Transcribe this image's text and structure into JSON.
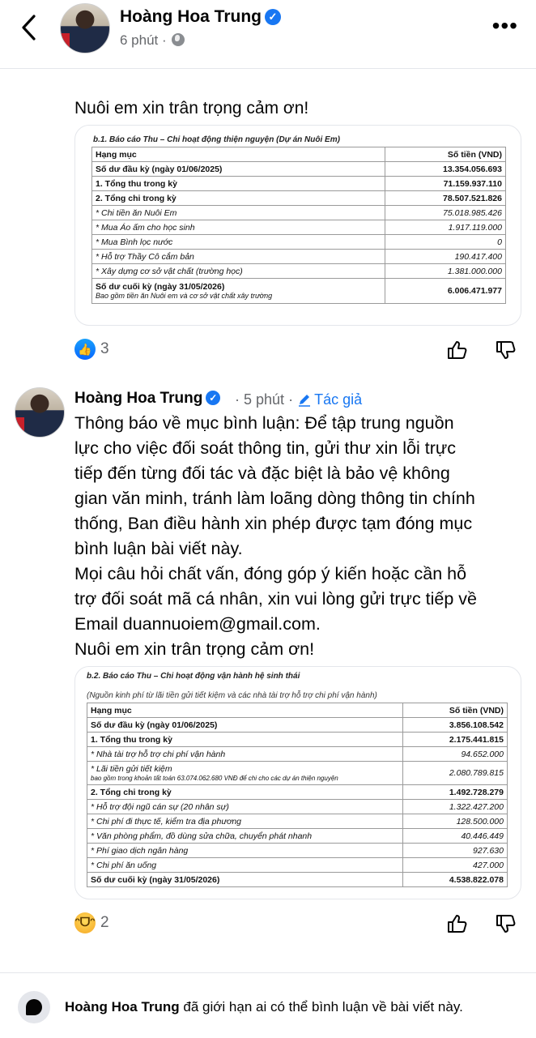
{
  "header": {
    "author": "Hoàng Hoa Trung",
    "time": "6 phút",
    "separator": "·",
    "verified_icon": "verified-badge-icon"
  },
  "post": {
    "text_tail": "Nuôi em xin trân trọng cảm ơn!",
    "table": {
      "title": "b.1. Báo cáo Thu – Chi hoạt động thiện nguyện (Dự án Nuôi Em)",
      "headers": [
        "Hạng mục",
        "Số tiền (VND)"
      ],
      "rows": [
        {
          "label": "Số dư đầu kỳ (ngày 01/06/2025)",
          "amount": "13.354.056.693"
        },
        {
          "label": "1. Tổng thu trong kỳ",
          "amount": "71.159.937.110"
        },
        {
          "label": "2. Tổng chi trong kỳ",
          "amount": "78.507.521.826"
        },
        {
          "label": "* Chi tiền ăn Nuôi Em",
          "amount": "75.018.985.426"
        },
        {
          "label": "* Mua Áo ấm cho học sinh",
          "amount": "1.917.119.000"
        },
        {
          "label": "* Mua Bình lọc nước",
          "amount": "0"
        },
        {
          "label": "* Hỗ trợ Thầy Cô cắm bản",
          "amount": "190.417.400"
        },
        {
          "label": "* Xây dựng cơ sở vật chất (trường học)",
          "amount": "1.381.000.000"
        }
      ],
      "final_label": "Số dư cuối kỳ (ngày 31/05/2026)",
      "final_sub": "Bao gồm tiền ăn Nuôi em và cơ sở vật chất xây trường",
      "final_amount": "6.006.471.977"
    },
    "reactions": {
      "count": "3",
      "icon": "like-icon"
    }
  },
  "comment": {
    "author": "Hoàng Hoa Trung",
    "time": "5 phút",
    "separator": "·",
    "author_tag": "Tác giả",
    "lines": [
      "Thông báo về mục bình luận: Để tập trung nguồn",
      "lực cho việc đối soát thông tin, gửi thư xin lỗi trực",
      "tiếp đến từng đối tác và đặc biệt là bảo vệ không",
      "gian văn minh, tránh làm loãng dòng thông tin chính",
      "thống, Ban điều hành xin phép được tạm đóng mục",
      "bình luận bài viết này.",
      "Mọi câu hỏi chất vấn, đóng góp ý kiến hoặc cần hỗ",
      "trợ đối soát mã cá nhân, xin vui lòng gửi trực tiếp về",
      "Email duannuoiem@gmail.com.",
      "Nuôi em xin trân trọng cảm ơn!"
    ],
    "table": {
      "title": "b.2. Báo cáo Thu – Chi hoạt động vận hành hệ sinh thái",
      "note": "(Nguồn kinh phí từ lãi tiền gửi tiết kiệm và các nhà tài trợ hỗ trợ chi phí vận hành)",
      "headers": [
        "Hạng mục",
        "Số tiền (VND)"
      ],
      "rows": [
        {
          "label": "Số dư đầu kỳ (ngày 01/06/2025)",
          "amount": "3.856.108.542"
        },
        {
          "label": "1. Tổng thu trong kỳ",
          "amount": "2.175.441.815"
        },
        {
          "label": "* Nhà tài trợ hỗ trợ chi phí vận hành",
          "amount": "94.652.000"
        },
        {
          "label": "* Lãi tiền gửi tiết kiệm",
          "sub": "bao gồm trong khoản tất toán 63.074.062.680 VNĐ để chi cho các dự án thiện nguyện",
          "amount": "2.080.789.815"
        },
        {
          "label": "2. Tổng chi trong kỳ",
          "amount": "1.492.728.279"
        },
        {
          "label": "* Hỗ trợ đội ngũ cán sự (20 nhân sự)",
          "amount": "1.322.427.200"
        },
        {
          "label": "* Chi phí đi thực tế, kiểm tra địa phương",
          "amount": "128.500.000"
        },
        {
          "label": "* Văn phòng phẩm, đồ dùng sửa chữa, chuyển phát nhanh",
          "amount": "40.446.449"
        },
        {
          "label": "* Phí giao dịch ngân hàng",
          "amount": "927.630"
        },
        {
          "label": "* Chi phí ăn uống",
          "amount": "427.000"
        },
        {
          "label": "Số dư cuối kỳ (ngày 31/05/2026)",
          "amount": "4.538.822.078"
        }
      ]
    },
    "reactions": {
      "count": "2",
      "icon": "haha-icon"
    }
  },
  "footer": {
    "name": "Hoàng Hoa Trung",
    "text": " đã giới hạn ai có thể bình luận về bài viết này."
  },
  "colors": {
    "accent": "#1877f2",
    "secondary_text": "#65676b",
    "divider": "#e4e6eb"
  }
}
